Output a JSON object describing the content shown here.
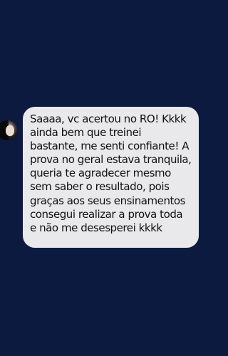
{
  "conversation": {
    "messages": [
      {
        "direction": "incoming",
        "text": "Saaaa, vc acertou no RO! Kkkk\nainda bem que treinei\nbastante, me senti confiante! A\nprova no geral estava tranquila,\nqueria te agradecer mesmo\nsem saber o resultado, pois\ngraças aos seus ensinamentos\nconsegui realizar a prova toda\ne não me desesperei kkkk"
      }
    ]
  },
  "colors": {
    "background": "#0c1a3f",
    "incoming_bubble": "#e9e9eb",
    "text": "#111111"
  },
  "icons": {
    "sender_avatar": "avatar-photo"
  }
}
